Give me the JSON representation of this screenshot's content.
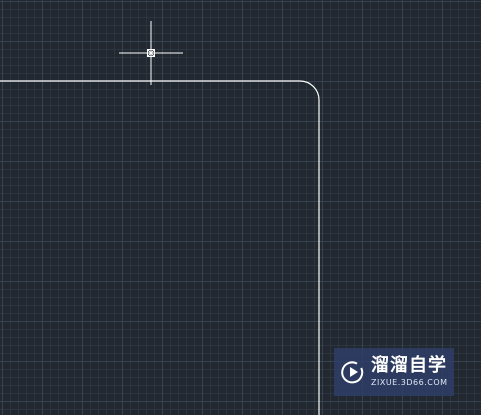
{
  "canvas": {
    "background": "#212830",
    "grid_minor_color": "#2c3540",
    "grid_major_color": "#374350",
    "entity_color": "#ffffff",
    "cursor_color": "#ffffff"
  },
  "cursor": {
    "icon": "crosshair-cursor-icon"
  },
  "watermark": {
    "title": "溜溜自学",
    "subtitle": "ZIXUE.3D66.COM",
    "logo_icon": "play-logo-icon",
    "background": "#2e406c"
  }
}
